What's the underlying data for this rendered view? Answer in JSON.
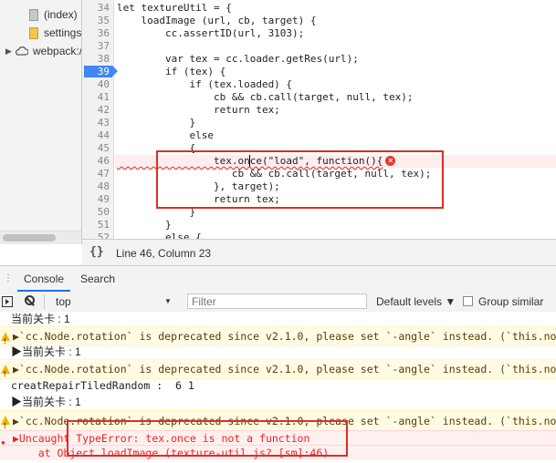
{
  "tree": {
    "items": [
      {
        "label": "(index)",
        "icon": "file-icon"
      },
      {
        "label": "settings",
        "icon": "folder-icon"
      },
      {
        "label": "webpack://",
        "icon": "cloud-icon"
      }
    ]
  },
  "editor": {
    "lines": [
      {
        "num": "34",
        "text": "let textureUtil = {"
      },
      {
        "num": "35",
        "text": "    loadImage (url, cb, target) {"
      },
      {
        "num": "36",
        "text": "        cc.assertID(url, 3103);"
      },
      {
        "num": "37",
        "text": ""
      },
      {
        "num": "38",
        "text": "        var tex = cc.loader.getRes(url);"
      },
      {
        "num": "39",
        "text": "        if (tex) {"
      },
      {
        "num": "40",
        "text": "            if (tex.loaded) {"
      },
      {
        "num": "41",
        "text": "                cb && cb.call(target, null, tex);"
      },
      {
        "num": "42",
        "text": "                return tex;"
      },
      {
        "num": "43",
        "text": "            }"
      },
      {
        "num": "44",
        "text": "            else"
      },
      {
        "num": "45",
        "text": "            {"
      },
      {
        "num": "46",
        "text": "                tex.once(\"load\", function(){"
      },
      {
        "num": "47",
        "text": "                   cb && cb.call(target, null, tex);"
      },
      {
        "num": "48",
        "text": "                }, target);"
      },
      {
        "num": "49",
        "text": "                return tex;"
      },
      {
        "num": "50",
        "text": "            }"
      },
      {
        "num": "51",
        "text": "        }"
      },
      {
        "num": "52",
        "text": "        else {"
      }
    ],
    "breakpoint_line": "39",
    "error_line": "46"
  },
  "status": {
    "braces": "{}",
    "position": "Line 46, Column 23"
  },
  "drawer": {
    "more": "⋮",
    "tabs": [
      "Console",
      "Search"
    ],
    "active_tab": "Console"
  },
  "toolbar": {
    "context": "top",
    "filter_placeholder": "Filter",
    "levels": "Default levels ▼",
    "group_similar": "Group similar"
  },
  "console": {
    "messages": [
      {
        "type": "plain",
        "text": "当前关卡 : 1"
      },
      {
        "type": "warn",
        "text": "▶`cc.Node.rotation` is deprecated since v2.1.0, please set `-angle` instead. (`this.node.r"
      },
      {
        "type": "plain",
        "text": "▶当前关卡 : 1"
      },
      {
        "type": "warn",
        "text": "▶`cc.Node.rotation` is deprecated since v2.1.0, please set `-angle` instead. (`this.node.r"
      },
      {
        "type": "plain",
        "text": "creatRepairTiledRandom :  6 1"
      },
      {
        "type": "plain",
        "text": "▶当前关卡 : 1"
      },
      {
        "type": "warn",
        "text": "▶`cc.Node.rotation` is deprecated since v2.1.0, please set `-angle` instead. (`this.node.r"
      },
      {
        "type": "err",
        "text": "▶Uncaught TypeError: tex.once is not a function"
      },
      {
        "type": "err",
        "text": "    at Object.loadImage (texture-util.js? [sm]:46)"
      }
    ]
  },
  "colors": {
    "accent": "#1a73e8",
    "breakpoint": "#4285f4",
    "error": "#d93025",
    "warning_bg": "#fffbe5"
  }
}
